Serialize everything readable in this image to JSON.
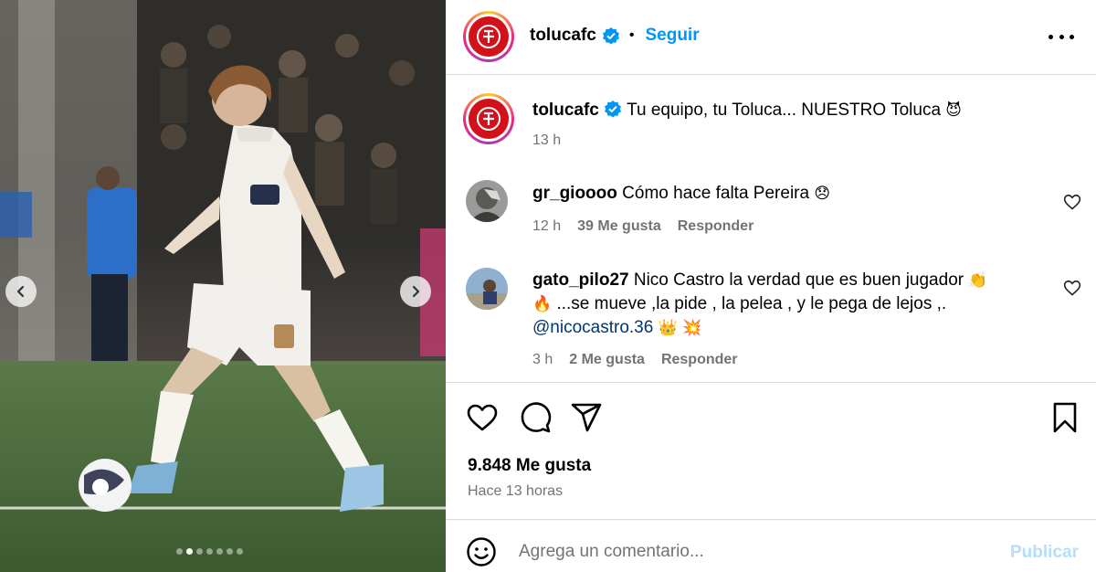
{
  "post": {
    "account": "tolucafc",
    "follow_label": "Seguir",
    "separator": "•",
    "caption": "Tu equipo, tu Toluca... NUESTRO Toluca",
    "caption_emoji": "😈",
    "caption_time": "13 h",
    "likes": "9.848 Me gusta",
    "posted_ago": "Hace 13 horas",
    "carousel": {
      "total": 7,
      "active_index": 1
    }
  },
  "comments": [
    {
      "user": "gr_gioooo",
      "text": "Cómo hace falta Pereira",
      "emoji": "😞",
      "time": "12 h",
      "likes": "39 Me gusta",
      "reply_label": "Responder"
    },
    {
      "user": "gato_pilo27",
      "text_line1": "Nico Castro la verdad que es buen jugador",
      "emoji1": "👏",
      "emoji2": "🔥",
      "text_line2": "...se mueve ,la pide , la pelea , y le pega de lejos ,.",
      "mention": "@nicocastro.36",
      "emoji3": "👑",
      "emoji4": "💥",
      "time": "3 h",
      "likes": "2 Me gusta",
      "reply_label": "Responder"
    }
  ],
  "composer": {
    "placeholder": "Agrega un comentario...",
    "publish_label": "Publicar"
  },
  "colors": {
    "accent": "#0095f6",
    "club_red": "#d3111b",
    "muted": "#737373",
    "border": "#dbdbdb",
    "publish_disabled": "#b2dffc"
  },
  "icons": [
    "chevron-left-icon",
    "chevron-right-icon",
    "verified-badge-icon",
    "more-options-icon",
    "heart-icon",
    "comment-icon",
    "share-icon",
    "bookmark-icon",
    "emoji-icon"
  ]
}
